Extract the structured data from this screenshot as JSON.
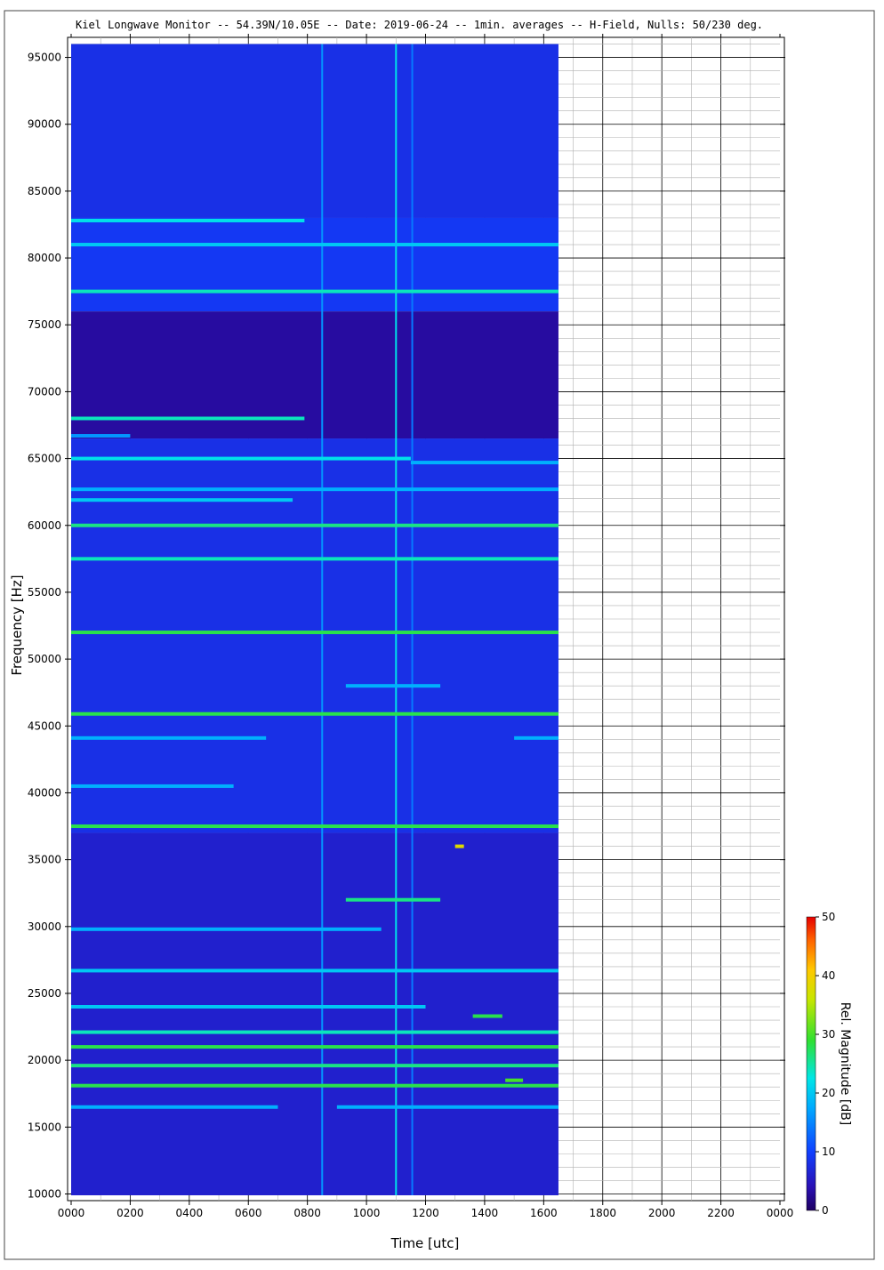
{
  "chart_data": {
    "type": "heatmap",
    "title": "Kiel Longwave Monitor -- 54.39N/10.05E -- Date: 2019-06-24 -- 1min. averages -- H-Field, Nulls: 50/230 deg.",
    "xlabel": "Time [utc]",
    "ylabel": "Frequency [Hz]",
    "colorbar_label": "Rel. Magnitude [dB]",
    "x_ticks": [
      "0000",
      "0200",
      "0400",
      "0600",
      "0800",
      "1000",
      "1200",
      "1400",
      "1600",
      "1800",
      "2000",
      "2200",
      "0000"
    ],
    "y_ticks": [
      "10000",
      "15000",
      "20000",
      "25000",
      "30000",
      "35000",
      "40000",
      "45000",
      "50000",
      "55000",
      "60000",
      "65000",
      "70000",
      "75000",
      "80000",
      "85000",
      "90000",
      "95000"
    ],
    "colorbar_ticks": [
      "0",
      "10",
      "20",
      "30",
      "40",
      "50"
    ],
    "xlim_hours": [
      0,
      24
    ],
    "ylim_hz": [
      9500,
      96500
    ],
    "clim_db": [
      0,
      50
    ],
    "data_extent": {
      "time_start_hours": 0,
      "time_end_hours": 16.5,
      "freq_min_hz": 9900,
      "freq_max_hz": 96000
    },
    "grid": true,
    "colormap": "jet",
    "background_regions": [
      {
        "fmin": 83000,
        "fmax": 96000,
        "db": 8
      },
      {
        "fmin": 76000,
        "fmax": 83000,
        "db": 9
      },
      {
        "fmin": 66500,
        "fmax": 76000,
        "db": 3
      },
      {
        "fmin": 37000,
        "fmax": 66500,
        "db": 8
      },
      {
        "fmin": 9900,
        "fmax": 37000,
        "db": 6
      }
    ],
    "bands": [
      {
        "freq": 82800,
        "t0": 0,
        "t1": 7.9,
        "db": 22
      },
      {
        "freq": 81000,
        "t0": 0,
        "t1": 16.5,
        "db": 20
      },
      {
        "freq": 77500,
        "t0": 0,
        "t1": 16.5,
        "db": 24
      },
      {
        "freq": 68000,
        "t0": 0,
        "t1": 7.9,
        "db": 24
      },
      {
        "freq": 66700,
        "t0": 0,
        "t1": 2.0,
        "db": 16
      },
      {
        "freq": 65000,
        "t0": 0,
        "t1": 11.5,
        "db": 22
      },
      {
        "freq": 64700,
        "t0": 11.5,
        "t1": 16.5,
        "db": 18
      },
      {
        "freq": 62700,
        "t0": 0,
        "t1": 16.5,
        "db": 18
      },
      {
        "freq": 61900,
        "t0": 0,
        "t1": 7.5,
        "db": 20
      },
      {
        "freq": 60000,
        "t0": 0,
        "t1": 16.5,
        "db": 26
      },
      {
        "freq": 57500,
        "t0": 0,
        "t1": 16.5,
        "db": 24
      },
      {
        "freq": 52000,
        "t0": 0,
        "t1": 16.5,
        "db": 28
      },
      {
        "freq": 48000,
        "t0": 9.3,
        "t1": 12.5,
        "db": 18
      },
      {
        "freq": 45900,
        "t0": 0,
        "t1": 16.5,
        "db": 28
      },
      {
        "freq": 44100,
        "t0": 0,
        "t1": 6.6,
        "db": 18
      },
      {
        "freq": 44100,
        "t0": 15.0,
        "t1": 16.5,
        "db": 18
      },
      {
        "freq": 40500,
        "t0": 0,
        "t1": 5.5,
        "db": 18
      },
      {
        "freq": 37500,
        "t0": 0,
        "t1": 16.5,
        "db": 28
      },
      {
        "freq": 36000,
        "t0": 13.0,
        "t1": 13.3,
        "db": 38
      },
      {
        "freq": 32000,
        "t0": 9.3,
        "t1": 12.5,
        "db": 26
      },
      {
        "freq": 29800,
        "t0": 0,
        "t1": 10.5,
        "db": 18
      },
      {
        "freq": 26700,
        "t0": 0,
        "t1": 16.5,
        "db": 20
      },
      {
        "freq": 24000,
        "t0": 0,
        "t1": 12.0,
        "db": 20
      },
      {
        "freq": 23300,
        "t0": 13.6,
        "t1": 14.6,
        "db": 28
      },
      {
        "freq": 22100,
        "t0": 0,
        "t1": 16.5,
        "db": 24
      },
      {
        "freq": 21000,
        "t0": 0,
        "t1": 16.5,
        "db": 28
      },
      {
        "freq": 19600,
        "t0": 0,
        "t1": 16.5,
        "db": 26
      },
      {
        "freq": 18500,
        "t0": 14.7,
        "t1": 15.3,
        "db": 30
      },
      {
        "freq": 18100,
        "t0": 0,
        "t1": 16.5,
        "db": 28
      },
      {
        "freq": 16500,
        "t0": 0,
        "t1": 7.0,
        "db": 18
      },
      {
        "freq": 16500,
        "t0": 9.0,
        "t1": 16.5,
        "db": 18
      }
    ],
    "vertical_lines": [
      {
        "t": 8.5,
        "db": 16
      },
      {
        "t": 11.0,
        "db": 22
      },
      {
        "t": 11.55,
        "db": 14
      }
    ]
  }
}
